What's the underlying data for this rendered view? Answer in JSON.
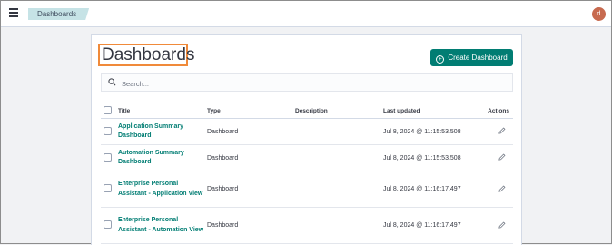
{
  "header": {
    "breadcrumb": "Dashboards",
    "avatar_initial": "d"
  },
  "page": {
    "title": "Dashboards",
    "create_button": "Create Dashboard",
    "search_placeholder": "Search..."
  },
  "table": {
    "columns": [
      "Title",
      "Type",
      "Description",
      "Last updated",
      "Actions"
    ],
    "rows": [
      {
        "title": "Application Summary Dashboard",
        "type": "Dashboard",
        "description": "",
        "updated": "Jul 8, 2024 @ 11:15:53.508"
      },
      {
        "title": "Automation Summary Dashboard",
        "type": "Dashboard",
        "description": "",
        "updated": "Jul 8, 2024 @ 11:15:53.508"
      },
      {
        "title": "Enterprise Personal Assistant - Application View",
        "type": "Dashboard",
        "description": "",
        "updated": "Jul 8, 2024 @ 11:16:17.497"
      },
      {
        "title": "Enterprise Personal Assistant - Automation View",
        "type": "Dashboard",
        "description": "",
        "updated": "Jul 8, 2024 @ 11:16:17.497"
      }
    ]
  },
  "colors": {
    "accent": "#017d73",
    "highlight_box": "#f08a3a",
    "breadcrumb_bg": "#c6e3e6",
    "avatar_bg": "#c76a4f"
  },
  "icons": {
    "menu": "hamburger-menu-icon",
    "search": "search-icon",
    "create": "plus-circle-icon",
    "edit": "pencil-icon"
  }
}
